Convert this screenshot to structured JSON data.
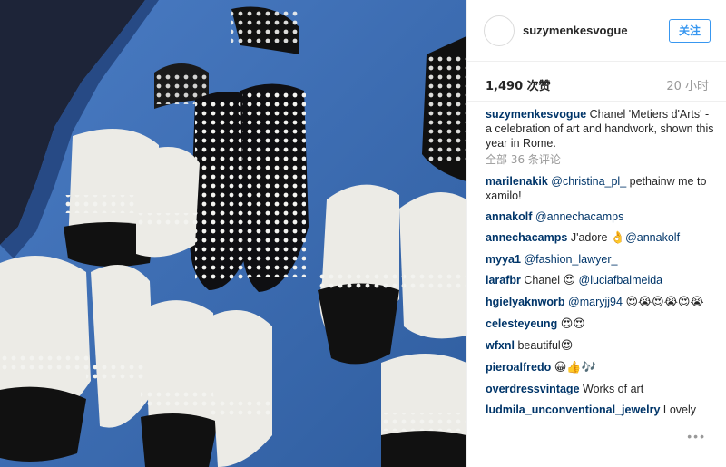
{
  "post": {
    "photo_alt": "Chanel pearl-embellished shoes on blue surface"
  },
  "header": {
    "username": "suzymenkesvogue",
    "follow_label": "关注"
  },
  "stats": {
    "likes": "1,490 次赞",
    "timestamp": "20 小时"
  },
  "caption": {
    "username": "suzymenkesvogue",
    "text": "Chanel 'Metiers d'Arts' - a celebration of art and handwork, shown this year in Rome."
  },
  "view_all": "全部 36 条评论",
  "comments": [
    {
      "user": "marilenakik",
      "mention": "@christina_pl_",
      "text": " pethainw me to xamilo!"
    },
    {
      "user": "annakolf",
      "mention": "@annechacamps",
      "text": ""
    },
    {
      "user": "annechacamps",
      "text_before": "J'adore ",
      "emoji": "👌",
      "mention": "@annakolf"
    },
    {
      "user": "myya1",
      "mention": "@fashion_lawyer_",
      "text": ""
    },
    {
      "user": "larafbr",
      "text_before": "Chanel ",
      "emoji": "😍",
      "mention": "@luciafbalmeida"
    },
    {
      "user": "hgielyaknworb",
      "mention": "@maryjj94",
      "emoji": "😍😭😍😭😍😭"
    },
    {
      "user": "celesteyeung",
      "emoji": "😍😍"
    },
    {
      "user": "wfxnl",
      "text_before": "beautiful",
      "emoji": "😍"
    },
    {
      "user": "pieroalfredo",
      "emoji": "😀👍🎶"
    },
    {
      "user": "overdressvintage",
      "text_before": "Works of art"
    },
    {
      "user": "ludmila_unconventional_jewelry",
      "text_before": "Lovely"
    }
  ],
  "more_label": "•••",
  "colors": {
    "accent": "#3897f0",
    "username": "#003569",
    "muted": "#999999",
    "photo_bg": "#3f6fb4"
  }
}
